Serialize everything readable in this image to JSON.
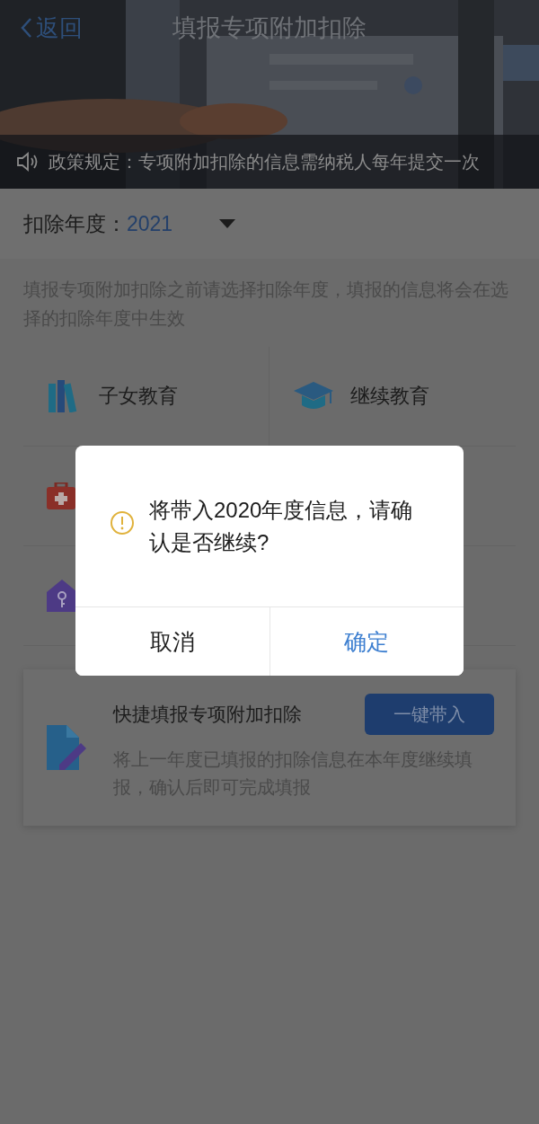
{
  "nav": {
    "back": "返回",
    "title": "填报专项附加扣除"
  },
  "notice": "政策规定：专项附加扣除的信息需纳税人每年提交一次",
  "year": {
    "label": "扣除年度：",
    "value": "2021"
  },
  "description": "填报专项附加扣除之前请选择扣除年度，填报的信息将会在选择的扣除年度中生效",
  "categories": [
    {
      "label": "子女教育"
    },
    {
      "label": "继续教育"
    }
  ],
  "quick": {
    "title": "快捷填报专项附加扣除",
    "button": "一键带入",
    "text": "将上一年度已填报的扣除信息在本年度继续填报，确认后即可完成填报"
  },
  "dialog": {
    "message": "将带入2020年度信息，请确认是否继续?",
    "buttons": [
      {
        "label": "取消",
        "kind": "cancel"
      },
      {
        "label": "确定",
        "kind": "confirm"
      }
    ]
  }
}
